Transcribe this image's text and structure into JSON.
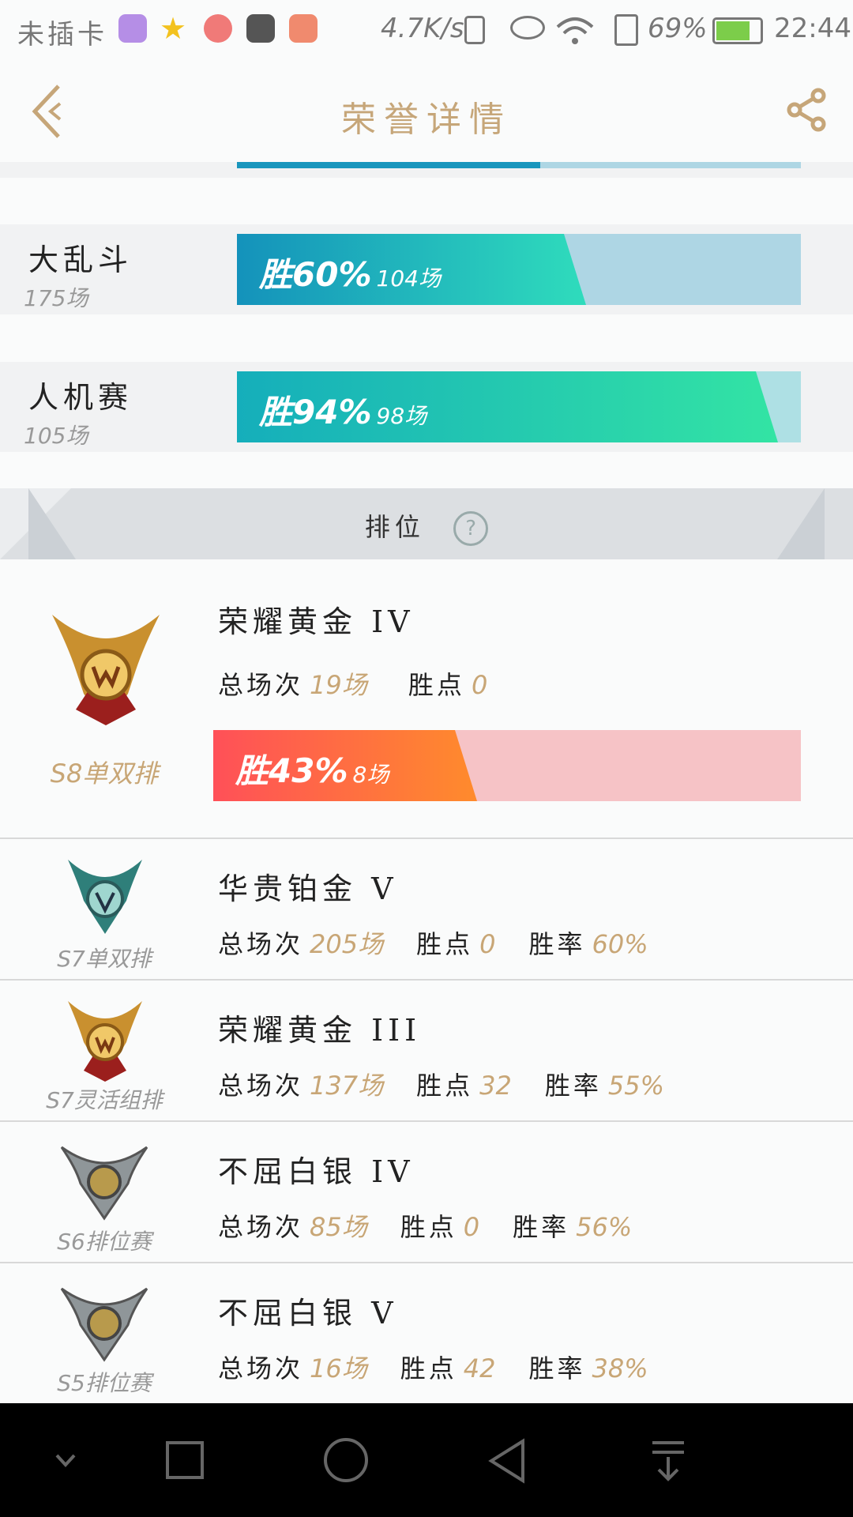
{
  "status_bar": {
    "carrier": "未插卡",
    "net_speed": "4.7K/s",
    "battery": "69%",
    "time": "22:44"
  },
  "header": {
    "title": "荣誉详情",
    "back_icon": "chevron-left-icon",
    "share_icon": "share-icon"
  },
  "modes": [
    {
      "name": "大乱斗",
      "count": "175场",
      "win_label": "胜60%",
      "games": "104场",
      "win_rate": 0.6
    },
    {
      "name": "人机赛",
      "count": "105场",
      "win_label": "胜94%",
      "games": "98场",
      "win_rate": 0.94
    }
  ],
  "ranked": {
    "title": "排位",
    "featured": {
      "tier": "荣耀黄金 IV",
      "season": "S8单双排",
      "total_label": "总场次",
      "total_value": "19场",
      "points_label": "胜点",
      "points_value": "0",
      "win_label": "胜43%",
      "games": "8场",
      "win_rate": 0.43
    },
    "entries": [
      {
        "tier": "华贵铂金 V",
        "season": "S7单双排",
        "total_label": "总场次",
        "total_value": "205场",
        "points_label": "胜点",
        "points_value": "0",
        "rate_label": "胜率",
        "rate_value": "60%",
        "emblem": "platinum"
      },
      {
        "tier": "荣耀黄金 III",
        "season": "S7灵活组排",
        "total_label": "总场次",
        "total_value": "137场",
        "points_label": "胜点",
        "points_value": "32",
        "rate_label": "胜率",
        "rate_value": "55%",
        "emblem": "gold"
      },
      {
        "tier": "不屈白银 IV",
        "season": "S6排位赛",
        "total_label": "总场次",
        "total_value": "85场",
        "points_label": "胜点",
        "points_value": "0",
        "rate_label": "胜率",
        "rate_value": "56%",
        "emblem": "silver"
      },
      {
        "tier": "不屈白银 V",
        "season": "S5排位赛",
        "total_label": "总场次",
        "total_value": "16场",
        "points_label": "胜点",
        "points_value": "42",
        "rate_label": "胜率",
        "rate_value": "38%",
        "emblem": "silver"
      }
    ]
  },
  "nav_bar": {
    "buttons": [
      "chevron-down-icon",
      "recents-square-icon",
      "home-circle-icon",
      "back-triangle-icon",
      "download-icon"
    ]
  },
  "colors": {
    "accent_gold": "#c6a679",
    "blue_fill_start": "#1996bd",
    "blue_fill_end": "#2ad8b6",
    "blue_track": "#aed6e4",
    "green_fill_end": "#30e0a4",
    "red_fill_start": "#ff5656",
    "red_fill_end": "#ff8a2e",
    "red_track": "#f6c3c6"
  }
}
